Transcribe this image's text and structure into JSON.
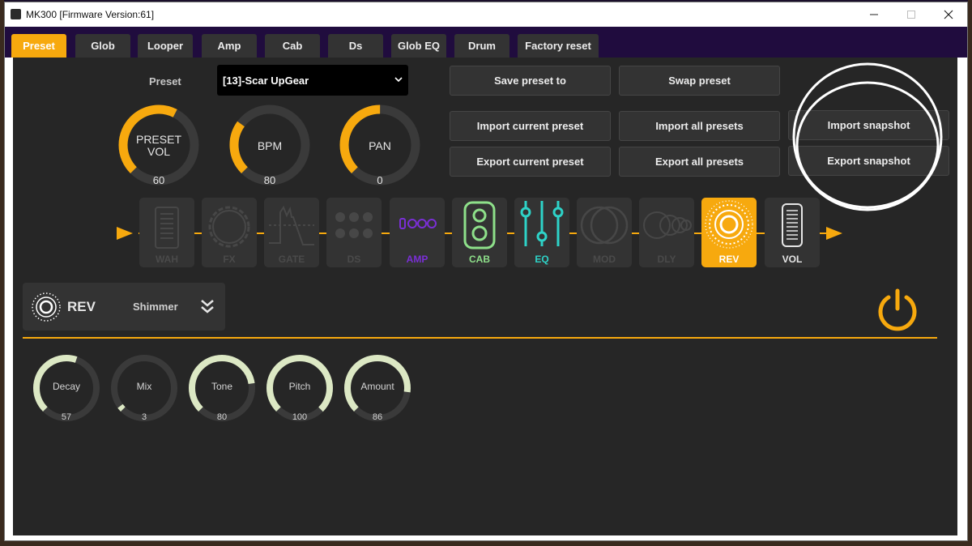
{
  "window": {
    "title": "MK300 [Firmware Version:61]"
  },
  "tabs": [
    {
      "label": "Preset",
      "active": true
    },
    {
      "label": "Glob"
    },
    {
      "label": "Looper"
    },
    {
      "label": "Amp"
    },
    {
      "label": "Cab"
    },
    {
      "label": "Ds"
    },
    {
      "label": "Glob EQ"
    },
    {
      "label": "Drum"
    },
    {
      "label": "Factory reset"
    }
  ],
  "preset": {
    "label": "Preset",
    "selected": "[13]-Scar UpGear"
  },
  "buttons": {
    "save_preset_to": "Save preset to",
    "swap_preset": "Swap preset",
    "import_current_preset": "Import current preset",
    "import_all_presets": "Import all presets",
    "import_snapshot": "Import  snapshot",
    "export_current_preset": "Export current preset",
    "export_all_presets": "Export all presets",
    "export_snapshot": "Export snapshot"
  },
  "main_knobs": [
    {
      "label_line1": "PRESET",
      "label_line2": "VOL",
      "value": "60",
      "fraction": 0.6
    },
    {
      "label": "BPM",
      "value": "80",
      "fraction": 0.3
    },
    {
      "label": "PAN",
      "value": "0",
      "fraction": 0.5
    }
  ],
  "chain": [
    {
      "label": "WAH",
      "state": "off"
    },
    {
      "label": "FX",
      "state": "off"
    },
    {
      "label": "GATE",
      "state": "off"
    },
    {
      "label": "DS",
      "state": "off"
    },
    {
      "label": "AMP",
      "state": "on",
      "color": "#7a2fd6"
    },
    {
      "label": "CAB",
      "state": "on",
      "color": "#8ee08a"
    },
    {
      "label": "EQ",
      "state": "on",
      "color": "#2ed3c8"
    },
    {
      "label": "MOD",
      "state": "off"
    },
    {
      "label": "DLY",
      "state": "off"
    },
    {
      "label": "REV",
      "state": "selected",
      "color": "#f7a90e"
    },
    {
      "label": "VOL",
      "state": "on",
      "color": "#e6e6e6"
    }
  ],
  "effect": {
    "name": "REV",
    "type": "Shimmer",
    "power_color": "#f7a90e"
  },
  "params": [
    {
      "label": "Decay",
      "value": "57",
      "fraction": 0.57
    },
    {
      "label": "Mix",
      "value": "3",
      "fraction": 0.03
    },
    {
      "label": "Tone",
      "value": "80",
      "fraction": 0.8
    },
    {
      "label": "Pitch",
      "value": "100",
      "fraction": 1.0
    },
    {
      "label": "Amount",
      "value": "86",
      "fraction": 0.86
    }
  ],
  "colors": {
    "accent": "#f7a90e",
    "panel": "#262626",
    "tab_bar": "#200c3e",
    "param_knob": "#dce8c4"
  },
  "icons": [
    "app-icon",
    "minimize-icon",
    "maximize-icon",
    "close-icon",
    "dropdown-arrow-icon",
    "chain-arrow-icon",
    "rev-icon",
    "double-chevron-down-icon",
    "power-icon"
  ]
}
